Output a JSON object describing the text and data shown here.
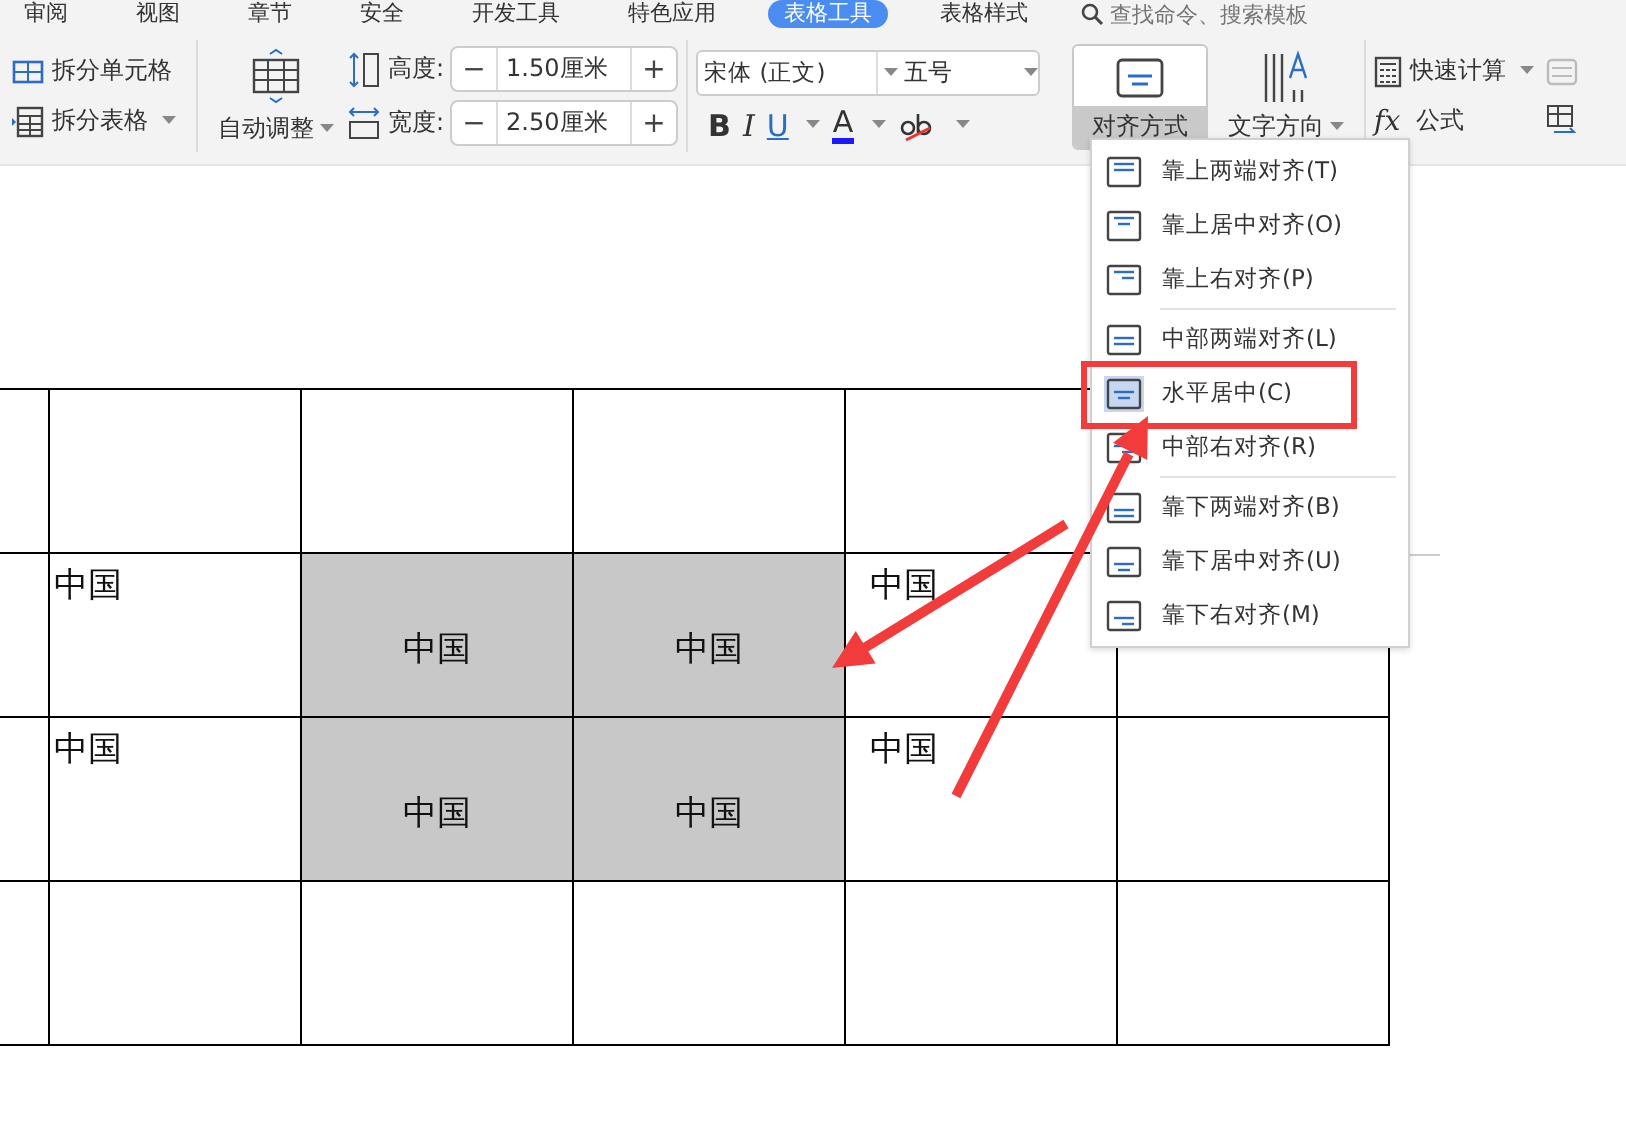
{
  "tabs": [
    {
      "label": "审阅",
      "selected": false
    },
    {
      "label": "视图",
      "selected": false
    },
    {
      "label": "章节",
      "selected": false
    },
    {
      "label": "安全",
      "selected": false
    },
    {
      "label": "开发工具",
      "selected": false
    },
    {
      "label": "特色应用",
      "selected": false
    },
    {
      "label": "表格工具",
      "selected": true
    },
    {
      "label": "表格样式",
      "selected": false
    }
  ],
  "search": {
    "placeholder": "查找命令、搜索模板"
  },
  "ribbon": {
    "split_cell": "拆分单元格",
    "split_table": "拆分表格",
    "auto_fit": "自动调整",
    "height": {
      "label": "高度:",
      "value": "1.50厘米",
      "minus": "−",
      "plus": "+"
    },
    "width": {
      "label": "宽度:",
      "value": "2.50厘米",
      "minus": "−",
      "plus": "+"
    },
    "font": "宋体 (正文)",
    "size": "五号",
    "bold": "B",
    "italic": "I",
    "underline": "U",
    "font_color": "A",
    "alignment": {
      "label": "对齐方式",
      "selected": true
    },
    "text_direction": "文字方向",
    "quick_calc": "快速计算",
    "formula_fx": "fx",
    "formula": "公式"
  },
  "alignment_menu": [
    [
      {
        "label": "靠上两端对齐(T)",
        "kind": "topjustify",
        "selected": false
      },
      {
        "label": "靠上居中对齐(O)",
        "kind": "topcenter",
        "selected": false
      },
      {
        "label": "靠上右对齐(P)",
        "kind": "topright",
        "selected": false
      }
    ],
    [
      {
        "label": "中部两端对齐(L)",
        "kind": "middlejustify",
        "selected": false
      },
      {
        "label": "水平居中(C)",
        "kind": "middlecenter",
        "selected": true
      },
      {
        "label": "中部右对齐(R)",
        "kind": "middleright",
        "selected": false
      }
    ],
    [
      {
        "label": "靠下两端对齐(B)",
        "kind": "bottomjustify",
        "selected": false
      },
      {
        "label": "靠下居中对齐(U)",
        "kind": "bottomcenter",
        "selected": false
      },
      {
        "label": "靠下右对齐(M)",
        "kind": "bottomright",
        "selected": false
      }
    ]
  ],
  "table": {
    "rows": [
      {
        "cells": [
          {
            "selected": false
          },
          {
            "selected": false
          },
          {
            "selected": false
          },
          {
            "selected": false
          },
          {
            "selected": false
          },
          {}
        ]
      },
      {
        "cells": [
          {
            "selected": false
          },
          {
            "text": "中国",
            "kind": "topleft",
            "selected": false
          },
          {
            "text": "中国",
            "kind": "centered",
            "selected": true
          },
          {
            "text": "中国",
            "kind": "centered",
            "selected": true
          },
          {
            "text": "中国",
            "kind": "topleft",
            "selected": false
          },
          {
            "selected": false
          }
        ]
      },
      {
        "cells": [
          {
            "selected": false
          },
          {
            "text": "中国",
            "kind": "topleft",
            "selected": false
          },
          {
            "text": "中国",
            "kind": "centered",
            "selected": true
          },
          {
            "text": "中国",
            "kind": "centered",
            "selected": true
          },
          {
            "text": "中国",
            "kind": "topleft",
            "selected": false
          },
          {
            "selected": false
          }
        ]
      },
      {
        "cells": [
          {
            "selected": false
          },
          {
            "selected": false
          },
          {
            "selected": false
          },
          {
            "selected": false
          },
          {
            "selected": false
          },
          {
            "selected": false
          }
        ]
      }
    ]
  },
  "annotations": [
    {
      "kind": "box"
    },
    {
      "kind": "arrow"
    },
    {
      "kind": "arrow"
    }
  ]
}
